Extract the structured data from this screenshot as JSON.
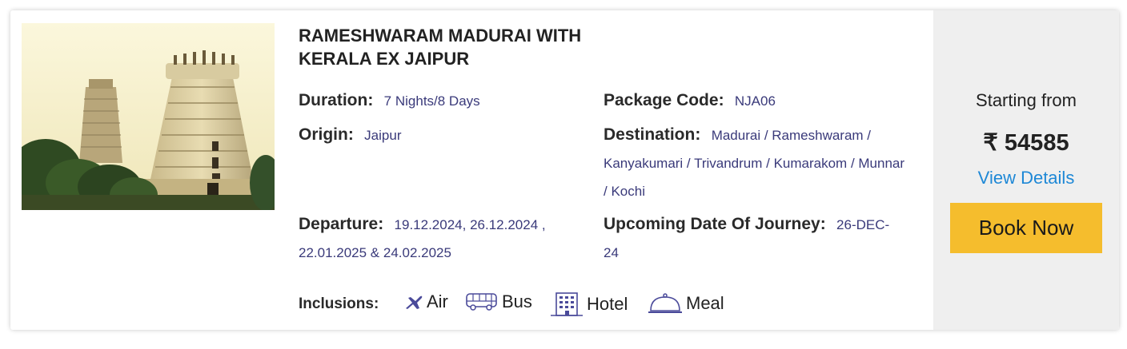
{
  "package": {
    "title": "RAMESHWARAM MADURAI WITH KERALA EX JAIPUR",
    "duration_label": "Duration:",
    "duration": "7 Nights/8 Days",
    "code_label": "Package Code:",
    "code": "NJA06",
    "origin_label": "Origin:",
    "origin": "Jaipur",
    "destination_label": "Destination:",
    "destination": "Madurai / Rameshwaram / Kanyakumari / Trivandrum / Kumarakom / Munnar / Kochi",
    "departure_label": "Departure:",
    "departure": "19.12.2024, 26.12.2024 , 22.01.2025 & 24.02.2025",
    "journey_label": "Upcoming Date Of Journey:",
    "journey": "26-DEC-24"
  },
  "inclusions": {
    "label": "Inclusions:",
    "items": [
      {
        "icon": "plane-icon",
        "label": "Air"
      },
      {
        "icon": "bus-icon",
        "label": "Bus"
      },
      {
        "icon": "hotel-icon",
        "label": "Hotel"
      },
      {
        "icon": "meal-icon",
        "label": "Meal"
      }
    ]
  },
  "pricing": {
    "starting_label": "Starting from",
    "price": "₹ 54585",
    "view_details": "View Details",
    "book_now": "Book Now"
  },
  "colors": {
    "accent_button": "#f5bd2d",
    "link": "#1e88d6",
    "value_text": "#3a3a7a",
    "icon": "#4a4a9a"
  }
}
